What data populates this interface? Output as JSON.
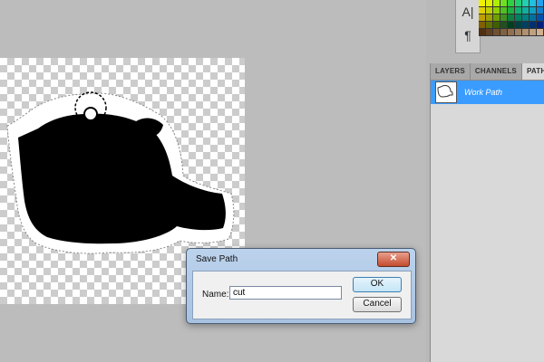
{
  "character_tools": [
    {
      "name": "character-icon",
      "glyph": "A|"
    },
    {
      "name": "paragraph-icon",
      "glyph": "¶"
    }
  ],
  "swatch_colors": [
    "#f0f000",
    "#e0f000",
    "#b0f000",
    "#70e020",
    "#30d040",
    "#20d070",
    "#20d0b0",
    "#20c0e0",
    "#20a0f0",
    "#e0d000",
    "#c0d000",
    "#90d000",
    "#50c020",
    "#20b040",
    "#10b070",
    "#10b0a0",
    "#10a0c0",
    "#1080d0",
    "#c0a000",
    "#a0a000",
    "#70a000",
    "#409020",
    "#108040",
    "#008060",
    "#008080",
    "#0070a0",
    "#0050b0",
    "#806000",
    "#607000",
    "#406000",
    "#205020",
    "#004020",
    "#004040",
    "#004060",
    "#003070",
    "#002080",
    "#503010",
    "#604020",
    "#705030",
    "#806040",
    "#907050",
    "#a08060",
    "#b09070",
    "#c0a080",
    "#d0b090"
  ],
  "layers_panel": {
    "tabs": [
      "LAYERS",
      "CHANNELS",
      "PATHS"
    ],
    "active_tab": "PATHS",
    "items": [
      {
        "label": "Work Path"
      }
    ]
  },
  "save_path_dialog": {
    "title": "Save Path",
    "close_glyph": "✕",
    "name_label": "Name:",
    "name_value": "cut",
    "ok_label": "OK",
    "cancel_label": "Cancel"
  },
  "colors": {
    "selection": "#3b9cff",
    "artwork": "#000000"
  }
}
